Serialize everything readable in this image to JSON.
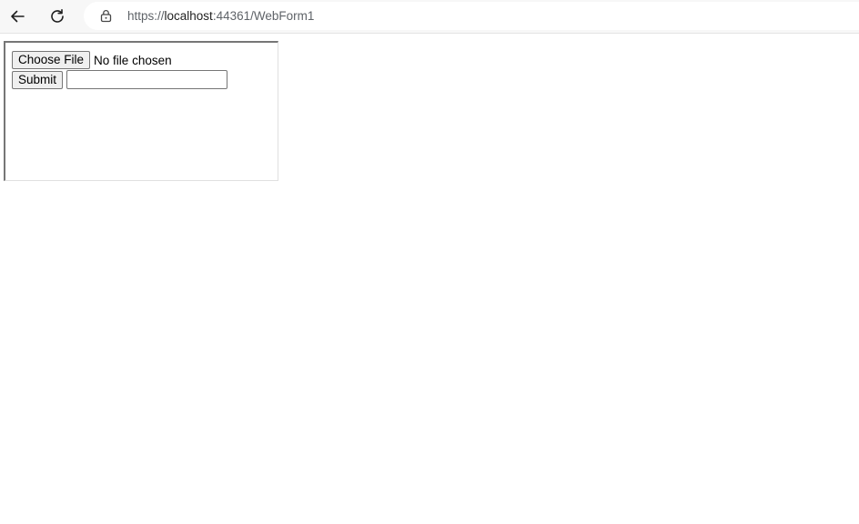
{
  "browser": {
    "back_icon": "arrow-left-icon",
    "reload_icon": "reload-icon",
    "lock_icon": "lock-icon",
    "url_scheme": "https://",
    "url_host": "localhost",
    "url_rest": ":44361/WebForm1"
  },
  "form": {
    "choose_file_label": "Choose File",
    "file_status": "No file chosen",
    "submit_label": "Submit",
    "text_value": "",
    "text_placeholder": ""
  }
}
